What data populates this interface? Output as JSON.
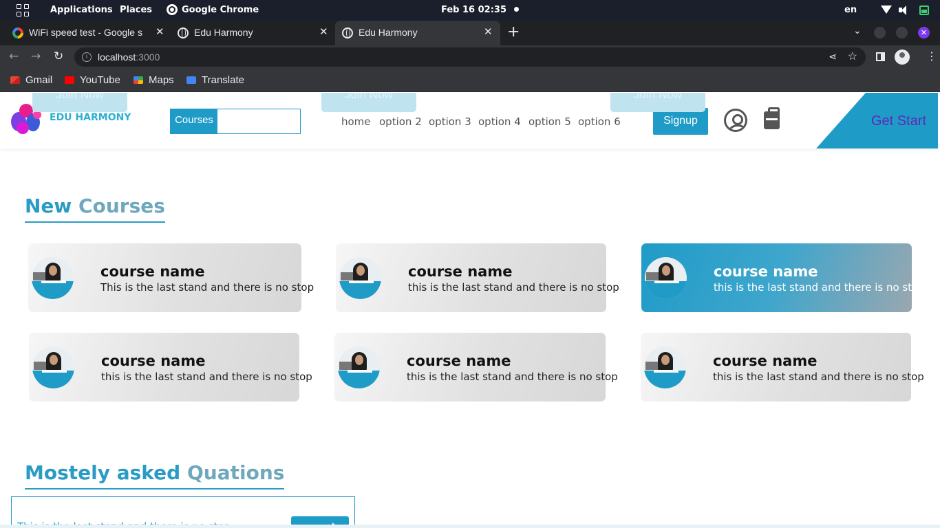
{
  "os_bar": {
    "applications": "Applications",
    "places": "Places",
    "active_app": "Google Chrome",
    "datetime": "Feb 16  02:35",
    "keyboard_layout": "en"
  },
  "browser": {
    "tabs": [
      {
        "title": "WiFi speed test - Google s",
        "icon": "google-icon",
        "active": false
      },
      {
        "title": "Edu Harmony",
        "icon": "globe-icon",
        "active": false
      },
      {
        "title": "Edu Harmony",
        "icon": "globe-icon",
        "active": true
      }
    ],
    "url_host": "localhost",
    "url_port": ":3000",
    "bookmarks": [
      {
        "label": "Gmail",
        "icon": "gmail-icon"
      },
      {
        "label": "YouTube",
        "icon": "youtube-icon"
      },
      {
        "label": "Maps",
        "icon": "maps-icon"
      },
      {
        "label": "Translate",
        "icon": "translate-icon"
      }
    ]
  },
  "site": {
    "join_buttons": [
      "Join Now",
      "Join Now",
      "Join Now"
    ],
    "logo_text": "EDU HARMONY",
    "search": {
      "button_label": "Courses",
      "placeholder": ""
    },
    "nav": [
      "home",
      "option 2",
      "option 3",
      "option 4",
      "option 5",
      "option 6"
    ],
    "signup_label": "Signup",
    "get_start_label": "Get Start",
    "accent_color": "#1f9bc8",
    "new_courses_title_1": "New",
    "new_courses_title_2": "Courses",
    "courses": [
      {
        "name": "course name",
        "description": "This is the last stand and there is no stop",
        "highlighted": false
      },
      {
        "name": "course name",
        "description": "this is the last stand and there is no stop",
        "highlighted": false
      },
      {
        "name": "course name",
        "description": "this is the last stand and there is no stop",
        "highlighted": true
      },
      {
        "name": "course name",
        "description": "this is the last stand and there is no stop",
        "highlighted": false
      },
      {
        "name": "course name",
        "description": "this is the last stand and there is no stop",
        "highlighted": false
      },
      {
        "name": "course name",
        "description": "this is the last stand and there is no stop",
        "highlighted": false
      }
    ],
    "faq_title_1": "Mostely",
    "faq_title_2": "asked",
    "faq_title_3": "Quations",
    "faq_item_text": "This is the last stand and there is no stop"
  }
}
